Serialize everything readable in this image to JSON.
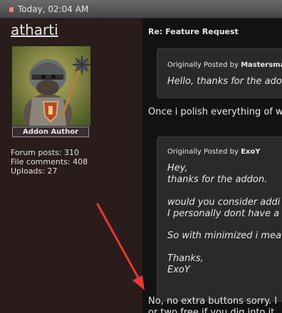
{
  "post": {
    "timestamp": "Today, 02:04 AM",
    "title": "Re: Feature Request"
  },
  "author": {
    "username": "atharti",
    "rank": "Addon Author",
    "stats": {
      "forum_posts": "Forum posts: 310",
      "file_comments": "File comments: 408",
      "uploads": "Uploads: 27"
    }
  },
  "quote1": {
    "prefix": "Originally Posted by",
    "author": "Mastersma",
    "text": "Hello, thanks for the ado"
  },
  "reply1": "Once i polish everything of w",
  "quote2": {
    "prefix": "Originally Posted by",
    "author": "ExoY",
    "lines": [
      "Hey,",
      "thanks for the addon.",
      "",
      "would you consider addi",
      "I personally dont have a",
      "",
      "So with minimized i mea",
      "",
      "Thanks,",
      "ExoY"
    ]
  },
  "reply2": [
    "No, no extra buttons sorry. I",
    "or two free if you dig into it"
  ],
  "colors": {
    "annotation_arrow": "#e53935",
    "topbar": "#555555",
    "sidebar": "#2a1c1a",
    "post_background": "#121212",
    "quote_background": "#2a2a2a"
  }
}
